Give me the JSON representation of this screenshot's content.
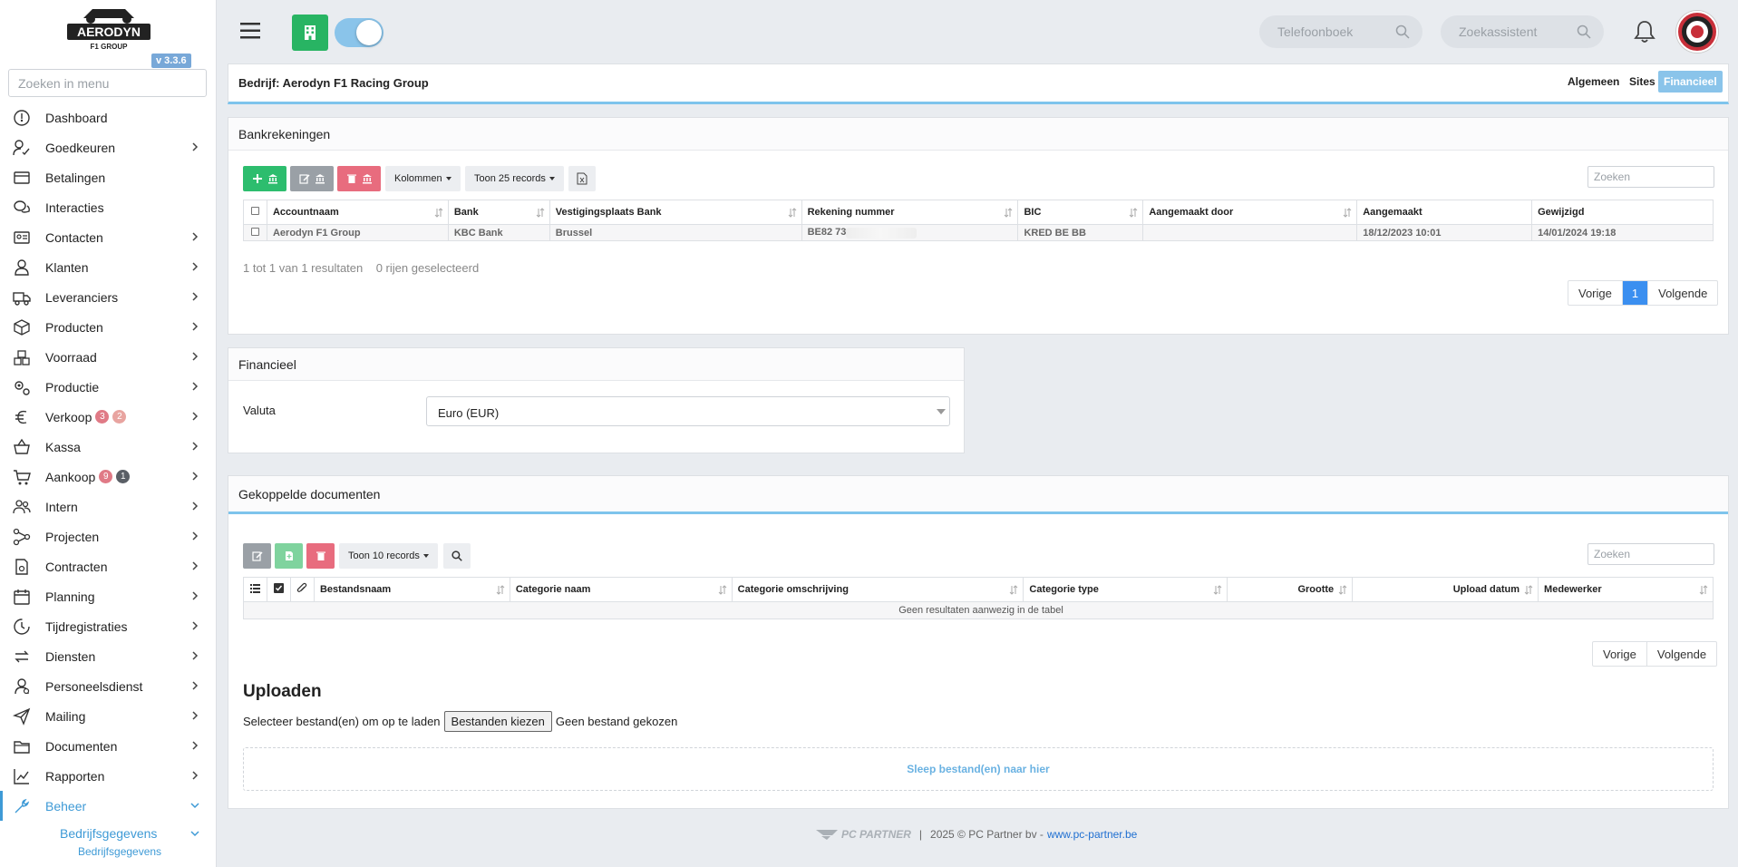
{
  "sidebar": {
    "logo_text": "AERODYN",
    "logo_subtext": "F1 GROUP",
    "version": "v 3.3.6",
    "search_placeholder": "Zoeken in menu",
    "items": [
      {
        "label": "Dashboard",
        "icon": "dashboard-icon",
        "chevron": false
      },
      {
        "label": "Goedkeuren",
        "icon": "approve-icon",
        "chevron": true
      },
      {
        "label": "Betalingen",
        "icon": "payments-icon",
        "chevron": false
      },
      {
        "label": "Interacties",
        "icon": "chat-icon",
        "chevron": false
      },
      {
        "label": "Contacten",
        "icon": "contacts-icon",
        "chevron": true
      },
      {
        "label": "Klanten",
        "icon": "customers-icon",
        "chevron": true
      },
      {
        "label": "Leveranciers",
        "icon": "truck-icon",
        "chevron": true
      },
      {
        "label": "Producten",
        "icon": "box-icon",
        "chevron": true
      },
      {
        "label": "Voorraad",
        "icon": "stock-icon",
        "chevron": true
      },
      {
        "label": "Productie",
        "icon": "gears-icon",
        "chevron": true
      },
      {
        "label": "Verkoop",
        "icon": "euro-icon",
        "chevron": true,
        "badges": [
          {
            "text": "3",
            "style": "b-red"
          },
          {
            "text": "2",
            "style": "b-pink"
          }
        ]
      },
      {
        "label": "Kassa",
        "icon": "basket-icon",
        "chevron": true
      },
      {
        "label": "Aankoop",
        "icon": "cart-icon",
        "chevron": true,
        "badges": [
          {
            "text": "9",
            "style": "b-red"
          },
          {
            "text": "1",
            "style": "b-dark"
          }
        ]
      },
      {
        "label": "Intern",
        "icon": "people-icon",
        "chevron": true
      },
      {
        "label": "Projecten",
        "icon": "projects-icon",
        "chevron": true
      },
      {
        "label": "Contracten",
        "icon": "contract-icon",
        "chevron": true
      },
      {
        "label": "Planning",
        "icon": "calendar-icon",
        "chevron": true
      },
      {
        "label": "Tijdregistraties",
        "icon": "time-icon",
        "chevron": true
      },
      {
        "label": "Diensten",
        "icon": "services-icon",
        "chevron": true
      },
      {
        "label": "Personeelsdienst",
        "icon": "personnel-icon",
        "chevron": true
      },
      {
        "label": "Mailing",
        "icon": "send-icon",
        "chevron": true
      },
      {
        "label": "Documenten",
        "icon": "folder-icon",
        "chevron": true
      },
      {
        "label": "Rapporten",
        "icon": "chart-icon",
        "chevron": true
      },
      {
        "label": "Beheer",
        "icon": "wrench-icon",
        "chevron": true,
        "active": true
      }
    ],
    "sub_item": "Bedrijfsgegevens",
    "sub_sub_item": "Bedrijfsgegevens"
  },
  "topbar": {
    "phonebook_placeholder": "Telefoonboek",
    "assistant_placeholder": "Zoekassistent"
  },
  "company": {
    "title": "Bedrijf: Aerodyn F1 Racing Group",
    "tabs": [
      "Algemeen",
      "Sites",
      "Financieel"
    ],
    "active_tab": "Financieel"
  },
  "bank": {
    "title": "Bankrekeningen",
    "columns_label": "Kolommen",
    "show_records_label": "Toon 25 records",
    "search_placeholder": "Zoeken",
    "headers": [
      "Accountnaam",
      "Bank",
      "Vestigingsplaats Bank",
      "Rekening nummer",
      "BIC",
      "Aangemaakt door",
      "Aangemaakt",
      "Gewijzigd"
    ],
    "rows": [
      [
        "Aerodyn F1 Group",
        "KBC Bank",
        "Brussel",
        "BE82 73",
        "KRED BE BB",
        "",
        "18/12/2023 10:01",
        "14/01/2024 19:18"
      ]
    ],
    "info": "1 tot 1 van 1 resultaten",
    "selected": "0 rijen geselecteerd",
    "prev": "Vorige",
    "page": "1",
    "next": "Volgende"
  },
  "financial": {
    "title": "Financieel",
    "currency_label": "Valuta",
    "currency_value": "Euro (EUR)"
  },
  "documents": {
    "title": "Gekoppelde documenten",
    "show_records_label": "Toon 10 records",
    "search_placeholder": "Zoeken",
    "headers": [
      "Bestandsnaam",
      "Categorie naam",
      "Categorie omschrijving",
      "Categorie type",
      "Grootte",
      "Upload datum",
      "Medewerker"
    ],
    "empty": "Geen resultaten aanwezig in de tabel",
    "prev": "Vorige",
    "next": "Volgende",
    "upload_title": "Uploaden",
    "upload_text": "Selecteer bestand(en) om op te laden",
    "choose_button": "Bestanden kiezen",
    "no_file": "Geen bestand gekozen",
    "drop_text": "Sleep bestand(en) naar hier"
  },
  "footer": {
    "brand": "PC PARTNER",
    "sep": "|",
    "copyright": "2025 © PC Partner bv -",
    "link": "www.pc-partner.be"
  },
  "colors": {
    "accent": "#3e9ad6",
    "green": "#2dbd6e",
    "red": "#e86c7e",
    "page_active": "#3b8ff0"
  }
}
